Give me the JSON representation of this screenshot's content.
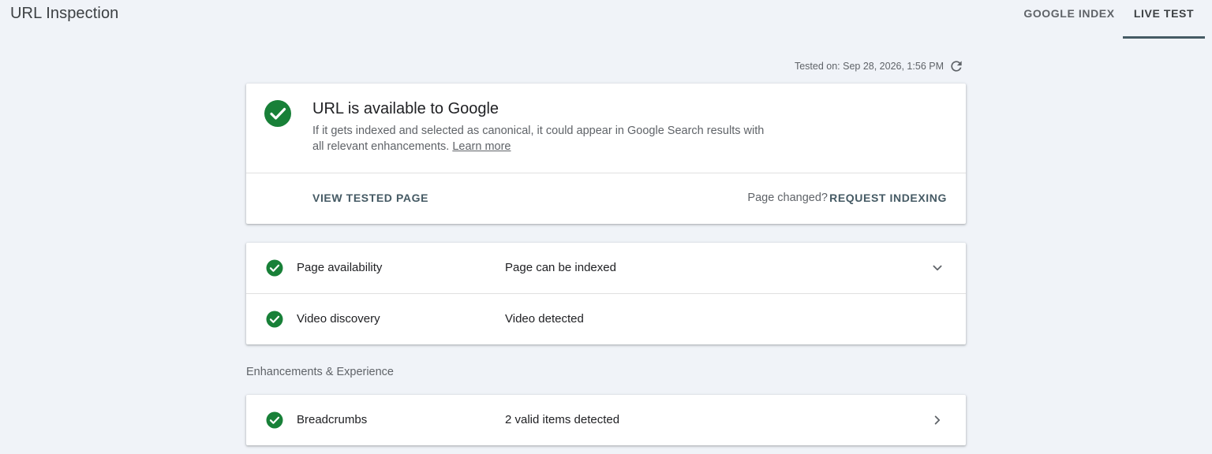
{
  "header": {
    "title": "URL Inspection",
    "tabs": [
      {
        "label": "GOOGLE INDEX",
        "active": false
      },
      {
        "label": "LIVE TEST",
        "active": true
      }
    ]
  },
  "tested_on": "Tested on: Sep 28, 2026, 1:56 PM",
  "status": {
    "title": "URL is available to Google",
    "description": "If it gets indexed and selected as canonical, it could appear in Google Search results with all relevant enhancements.",
    "learn_more": "Learn more",
    "view_tested_page": "VIEW TESTED PAGE",
    "page_changed": "Page changed?",
    "request_indexing": "REQUEST INDEXING"
  },
  "checks": [
    {
      "label": "Page availability",
      "value": "Page can be indexed",
      "icon": "check-circle-icon",
      "action_icon": "chevron-down-icon"
    },
    {
      "label": "Video discovery",
      "value": "Video detected",
      "icon": "check-circle-icon"
    }
  ],
  "enhancements": {
    "section_title": "Enhancements & Experience",
    "items": [
      {
        "label": "Breadcrumbs",
        "value": "2 valid items detected",
        "icon": "check-circle-icon",
        "action_icon": "chevron-right-icon"
      }
    ]
  },
  "colors": {
    "success": "#188038",
    "accent": "#455a64",
    "background": "#f0f3f8"
  }
}
